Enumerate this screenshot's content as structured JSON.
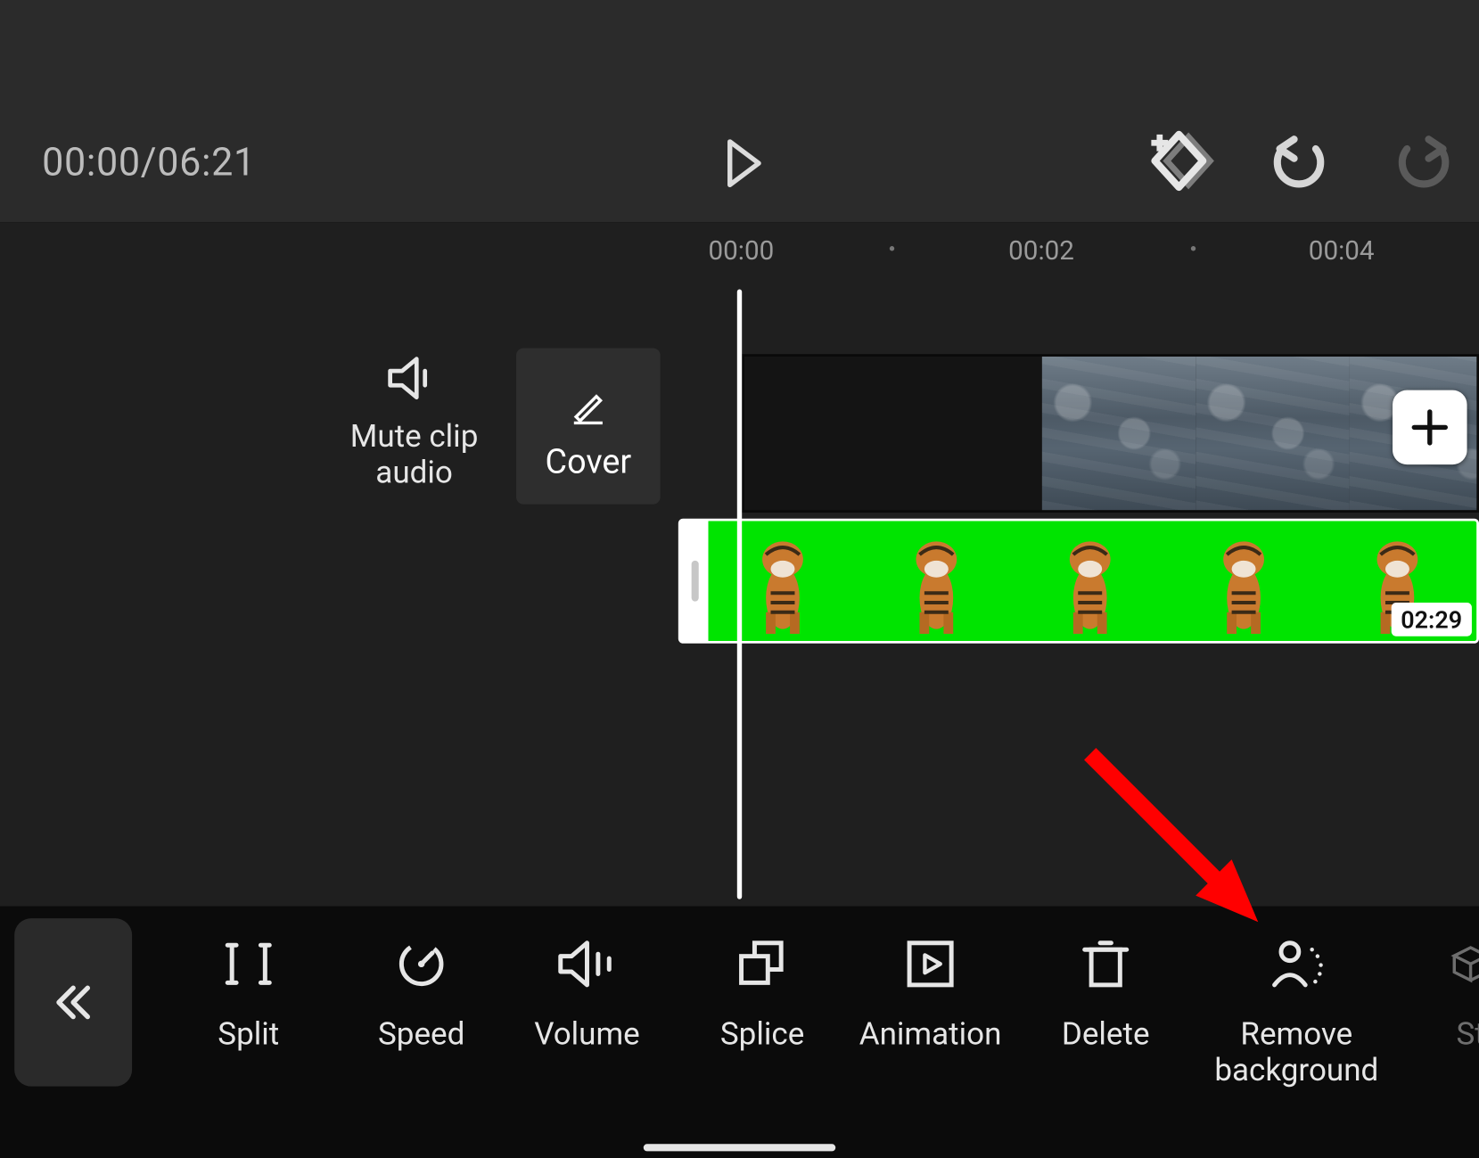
{
  "topbar": {
    "timecode_current": "00:00",
    "timecode_total": "06:21"
  },
  "ruler": {
    "ticks": [
      "00:00",
      "00:02",
      "00:04"
    ]
  },
  "timeline": {
    "mute_label_line1": "Mute clip",
    "mute_label_line2": "audio",
    "cover_label": "Cover",
    "overlay_clip_duration": "02:29"
  },
  "toolbar": {
    "split": "Split",
    "speed": "Speed",
    "volume": "Volume",
    "splice": "Splice",
    "animation": "Animation",
    "delete": "Delete",
    "remove_bg_line1": "Remove",
    "remove_bg_line2": "background",
    "next_item_partial": "St"
  }
}
